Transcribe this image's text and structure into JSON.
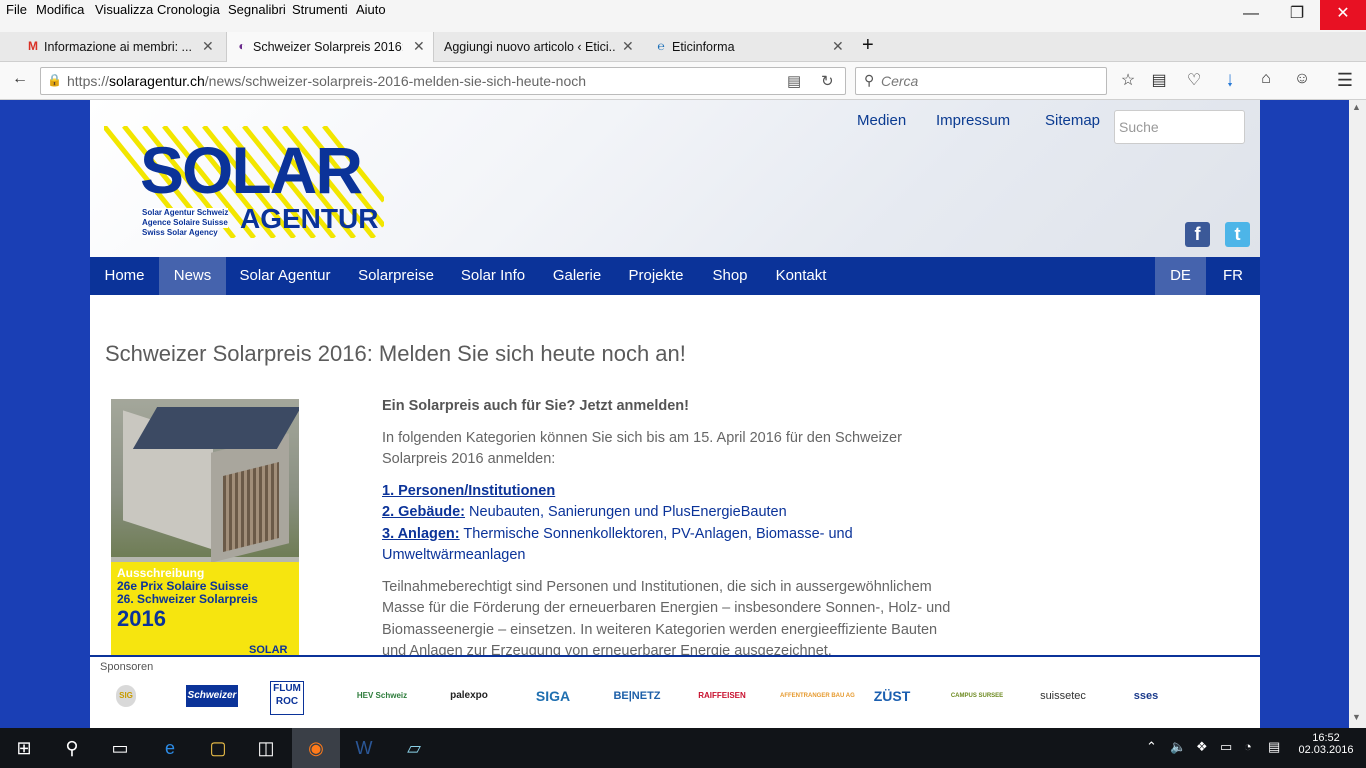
{
  "menubar": {
    "items": [
      "File",
      "Modifica",
      "Visualizza",
      "Cronologia",
      "Segnalibri",
      "Strumenti",
      "Aiuto"
    ]
  },
  "window": {
    "minimize": "—",
    "maximize": "❐",
    "close": "✕"
  },
  "tabs": [
    {
      "title": "Informazione ai membri: ...",
      "icon": "M"
    },
    {
      "title": "Schweizer Solarpreis 2016: ...",
      "icon": "◐"
    },
    {
      "title": "Aggiungi nuovo articolo ‹ Etici...",
      "icon": ""
    },
    {
      "title": "Eticinforma",
      "icon": "℮"
    }
  ],
  "tab_close": "✕",
  "new_tab": "+",
  "url": {
    "prefix": "https://",
    "host": "solaragentur.ch",
    "path": "/news/schweizer-solarpreis-2016-melden-sie-sich-heute-noch"
  },
  "search": {
    "placeholder": "Cerca"
  },
  "site": {
    "logo": {
      "main": "SOLAR",
      "sub": "AGENTUR",
      "lines": [
        "Solar Agentur Schweiz",
        "Agence Solaire Suisse",
        "Swiss Solar Agency"
      ]
    },
    "toplinks": [
      "Medien",
      "Impressum",
      "Sitemap"
    ],
    "search_placeholder": "Suche",
    "social": {
      "facebook": "f",
      "twitter": "t"
    },
    "nav": [
      "Home",
      "News",
      "Solar Agentur",
      "Solarpreise",
      "Solar Info",
      "Galerie",
      "Projekte",
      "Shop",
      "Kontakt"
    ],
    "lang": [
      "DE",
      "FR"
    ],
    "active_nav": "News"
  },
  "article": {
    "title": "Schweizer Solarpreis 2016: Melden Sie sich heute noch an!",
    "lead": "Ein Solarpreis auch für Sie? Jetzt anmelden!",
    "intro": "In folgenden Kategorien können Sie sich bis am 15. April 2016 für den Schweizer Solarpreis 2016 anmelden:",
    "cat1": "1. Personen/Institutionen",
    "cat2_label": "2. Gebäude:",
    "cat2_text": " Neubauten, Sanierungen und PlusEnergieBauten",
    "cat3_label": "3. Anlagen:",
    "cat3_text": " Thermische Sonnenkollektoren, PV-Anlagen, Biomasse- und Umweltwärmeanlagen",
    "body": "Teilnahmeberechtigt sind Personen und Institutionen, die sich in aussergewöhnlichem Masse für die Förderung der erneuerbaren Energien – insbesondere Sonnen-, Holz- und Biomasseenergie – einsetzen. In weiteren Kategorien werden energieeffiziente Bauten und Anlagen zur Erzeugung von erneuerbarer Energie ausgezeichnet.",
    "poster": {
      "line1": "Ausschreibung",
      "line2": "26e Prix Solaire Suisse",
      "line3": "26. Schweizer Solarpreis",
      "year": "2016",
      "brand": "SOLAR"
    }
  },
  "sponsors": {
    "title": "Sponsoren",
    "items": [
      "SIG",
      "Schweizer",
      "FLUMROC",
      "HEV Schweiz",
      "palexpo",
      "SIGA",
      "BE|NETZ",
      "RAIFFEISEN",
      "AFFENTRANGER BAU AG",
      "ZÜST",
      "CAMPUS SURSEE",
      "suissetec",
      "sses"
    ]
  },
  "taskbar": {
    "time": "16:52",
    "date": "02.03.2016"
  },
  "colors": {
    "brand_blue": "#0b3399",
    "nav_active": "#4563ad",
    "site_bg": "#1a3fb5",
    "logo_yellow": "#f2e600"
  }
}
